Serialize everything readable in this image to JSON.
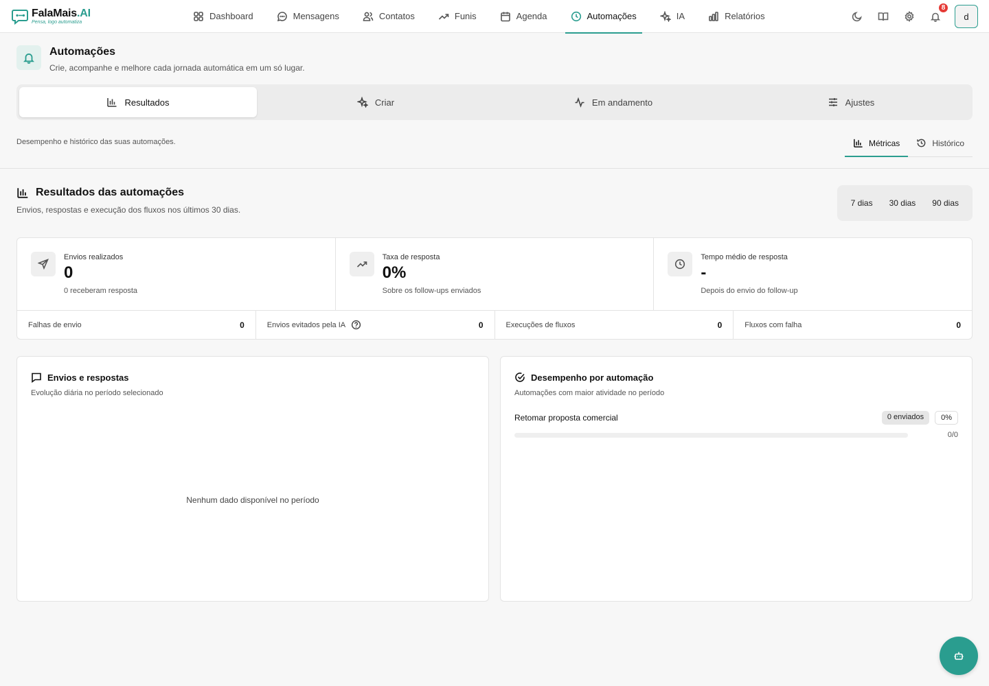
{
  "brand": {
    "name": "FalaMais",
    "name_suffix": ".AI",
    "tagline": "Pensa, logo automatiza"
  },
  "nav": {
    "items": [
      {
        "label": "Dashboard",
        "icon": "grid-icon"
      },
      {
        "label": "Mensagens",
        "icon": "message-icon"
      },
      {
        "label": "Contatos",
        "icon": "users-icon"
      },
      {
        "label": "Funis",
        "icon": "trending-icon"
      },
      {
        "label": "Agenda",
        "icon": "calendar-icon"
      },
      {
        "label": "Automações",
        "icon": "clock-icon",
        "active": true
      },
      {
        "label": "IA",
        "icon": "sparkles-icon"
      },
      {
        "label": "Relatórios",
        "icon": "bar-chart-icon"
      }
    ]
  },
  "topbar": {
    "notification_count": "8",
    "avatar_initial": "d"
  },
  "page": {
    "title": "Automações",
    "subtitle": "Crie, acompanhe e melhore cada jornada automática em um só lugar."
  },
  "tabs": [
    {
      "label": "Resultados",
      "active": true
    },
    {
      "label": "Criar"
    },
    {
      "label": "Em andamento"
    },
    {
      "label": "Ajustes"
    }
  ],
  "subsection": {
    "description": "Desempenho e histórico das suas automações.",
    "tabs": [
      {
        "label": "Métricas",
        "active": true
      },
      {
        "label": "Histórico"
      }
    ]
  },
  "results": {
    "title": "Resultados das automações",
    "subtitle": "Envios, respostas e execução dos fluxos nos últimos 30 dias.",
    "periods": [
      "7 dias",
      "30 dias",
      "90 dias"
    ],
    "kpis": [
      {
        "label": "Envios realizados",
        "value": "0",
        "hint": "0 receberam resposta",
        "icon": "send-icon"
      },
      {
        "label": "Taxa de resposta",
        "value": "0%",
        "hint": "Sobre os follow-ups enviados",
        "icon": "trending-icon"
      },
      {
        "label": "Tempo médio de resposta",
        "value": "-",
        "hint": "Depois do envio do follow-up",
        "icon": "clock-icon"
      }
    ],
    "mini": [
      {
        "label": "Falhas de envio",
        "value": "0"
      },
      {
        "label": "Envios evitados pela IA",
        "value": "0"
      },
      {
        "label": "Execuções de fluxos",
        "value": "0"
      },
      {
        "label": "Fluxos com falha",
        "value": "0"
      }
    ]
  },
  "panels": {
    "left": {
      "title": "Envios e respostas",
      "subtitle": "Evolução diária no período selecionado",
      "empty": "Nenhum dado disponível no período"
    },
    "right": {
      "title": "Desempenho por automação",
      "subtitle": "Automações com maior atividade no período",
      "rows": [
        {
          "name": "Retomar proposta comercial",
          "sent": "0 enviados",
          "rate": "0%",
          "ratio": "0/0",
          "progress": 0
        }
      ]
    }
  },
  "colors": {
    "accent": "#2a9d8f",
    "badge": "#e53935"
  }
}
